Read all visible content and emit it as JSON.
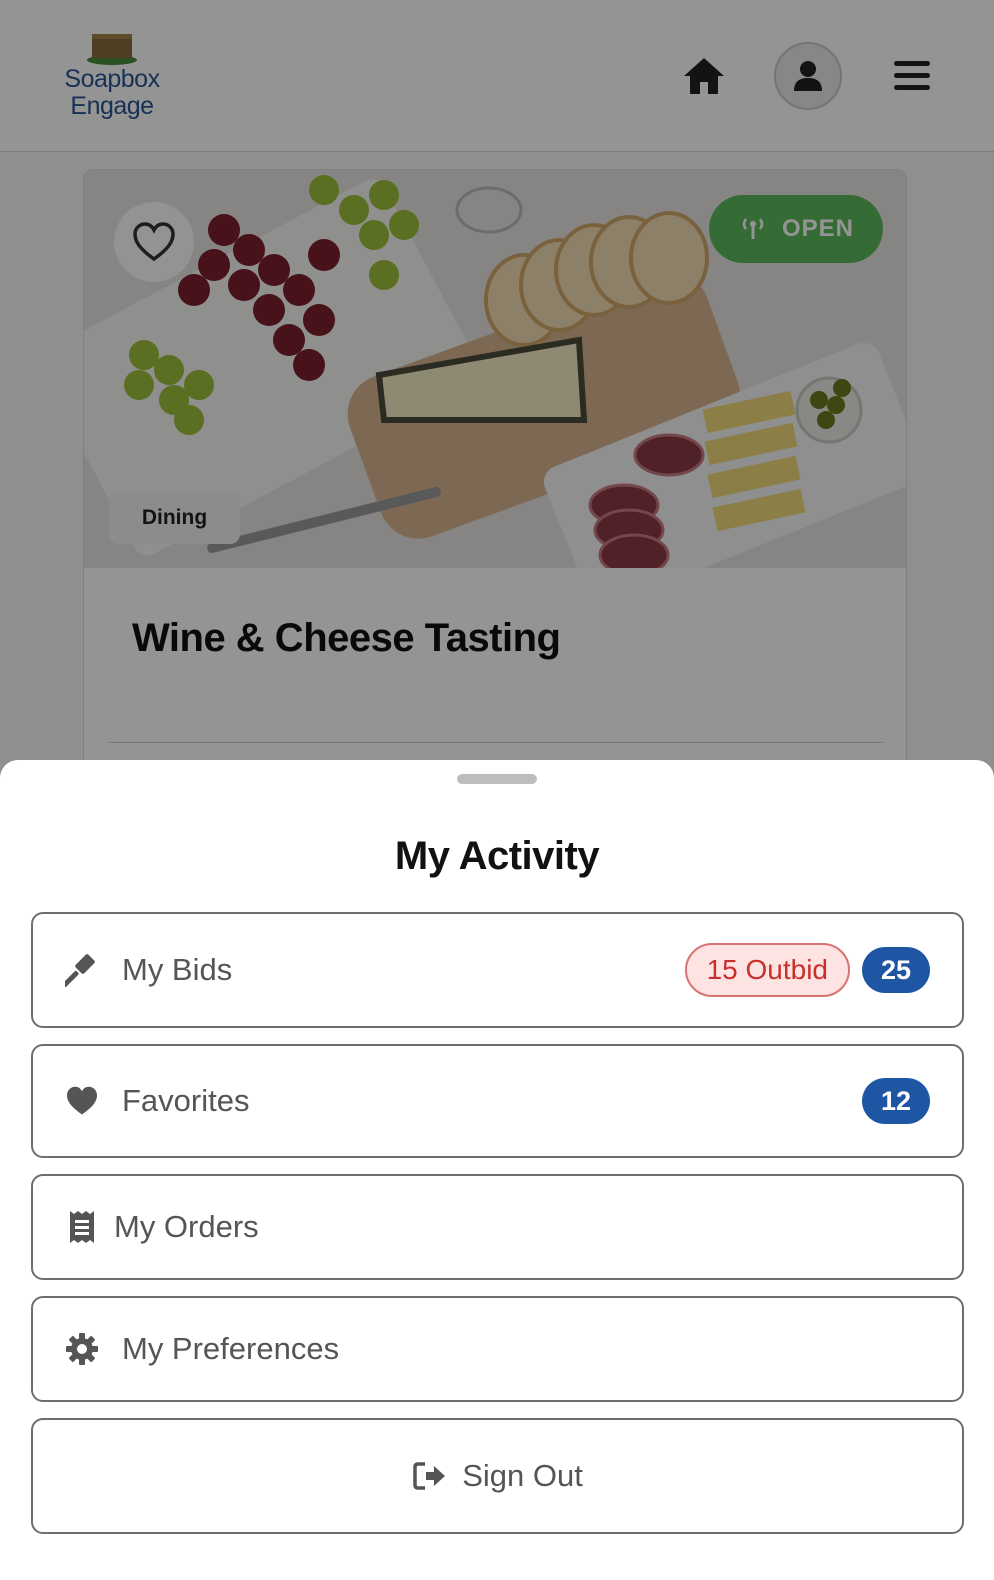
{
  "header": {
    "logo_line1": "Soapbox",
    "logo_line2": "Engage",
    "home_icon": "home-icon",
    "user_icon": "user-icon",
    "menu_icon": "hamburger-menu-icon"
  },
  "item_card": {
    "status": "OPEN",
    "category": "Dining",
    "title": "Wine & Cheese Tasting",
    "status_color": "#5cb85c"
  },
  "activity_sheet": {
    "title": "My Activity",
    "rows": [
      {
        "label": "My Bids",
        "icon": "gavel-icon",
        "outbid_label": "15 Outbid",
        "count": "25"
      },
      {
        "label": "Favorites",
        "icon": "heart-icon",
        "count": "12"
      },
      {
        "label": "My Orders",
        "icon": "receipt-icon"
      },
      {
        "label": "My Preferences",
        "icon": "gear-icon"
      },
      {
        "label": "Sign Out",
        "icon": "sign-out-icon"
      }
    ],
    "badge_color": "#1f56a4",
    "outbid_color": "#c9302c"
  }
}
